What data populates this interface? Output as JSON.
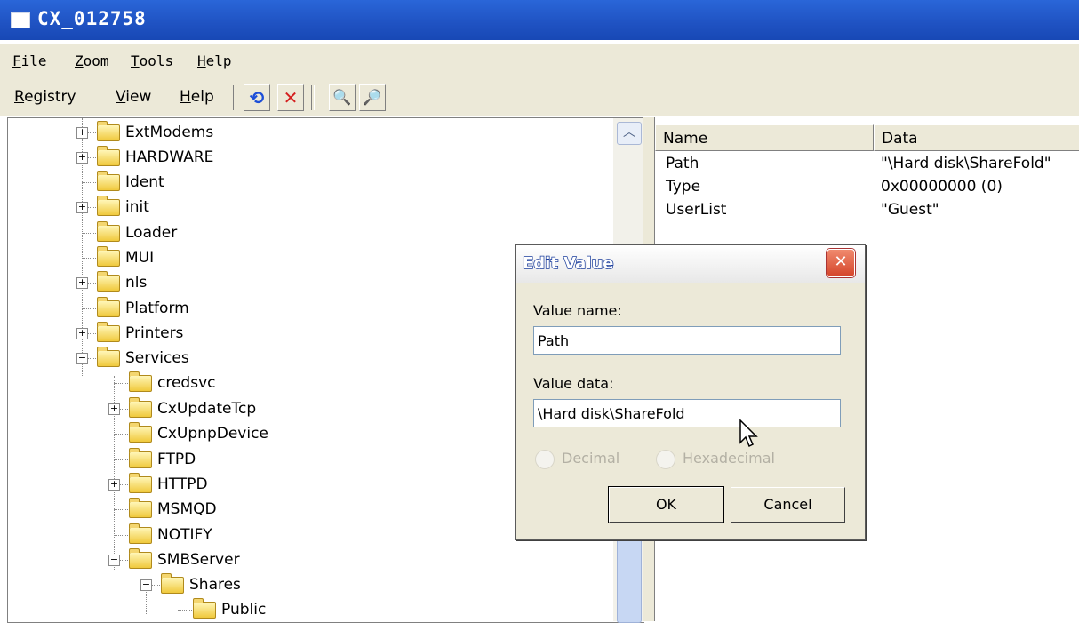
{
  "window": {
    "title": "CX_012758"
  },
  "menubar": [
    "File",
    "Zoom",
    "Tools",
    "Help"
  ],
  "toolbar": {
    "menus": [
      "Registry",
      "View",
      "Help"
    ],
    "buttons": [
      "refresh-icon",
      "delete-icon",
      "find-icon",
      "find-next-icon"
    ]
  },
  "tree": {
    "items": [
      {
        "label": "ExtModems",
        "expander": "+"
      },
      {
        "label": "HARDWARE",
        "expander": "+"
      },
      {
        "label": "Ident",
        "expander": ""
      },
      {
        "label": "init",
        "expander": "+"
      },
      {
        "label": "Loader",
        "expander": ""
      },
      {
        "label": "MUI",
        "expander": ""
      },
      {
        "label": "nls",
        "expander": "+"
      },
      {
        "label": "Platform",
        "expander": ""
      },
      {
        "label": "Printers",
        "expander": "+"
      },
      {
        "label": "Services",
        "expander": "−"
      },
      {
        "label": "credsvc",
        "expander": ""
      },
      {
        "label": "CxUpdateTcp",
        "expander": "+"
      },
      {
        "label": "CxUpnpDevice",
        "expander": ""
      },
      {
        "label": "FTPD",
        "expander": ""
      },
      {
        "label": "HTTPD",
        "expander": "+"
      },
      {
        "label": "MSMQD",
        "expander": ""
      },
      {
        "label": "NOTIFY",
        "expander": ""
      },
      {
        "label": "SMBServer",
        "expander": "−"
      },
      {
        "label": "Shares",
        "expander": "−"
      },
      {
        "label": "Public",
        "expander": ""
      }
    ]
  },
  "list": {
    "columns": [
      "Name",
      "Data"
    ],
    "rows": [
      {
        "name": "Path",
        "data": "\"\\Hard disk\\ShareFold\""
      },
      {
        "name": "Type",
        "data": "0x00000000 (0)"
      },
      {
        "name": "UserList",
        "data": "\"Guest\""
      }
    ]
  },
  "dialog": {
    "title": "Edit Value",
    "close_glyph": "✕",
    "value_name_label": "Value name:",
    "value_name": "Path",
    "value_data_label": "Value data:",
    "value_data": "\\Hard disk\\ShareFold",
    "radio_decimal": "Decimal",
    "radio_hex": "Hexadecimal",
    "ok": "OK",
    "cancel": "Cancel"
  }
}
